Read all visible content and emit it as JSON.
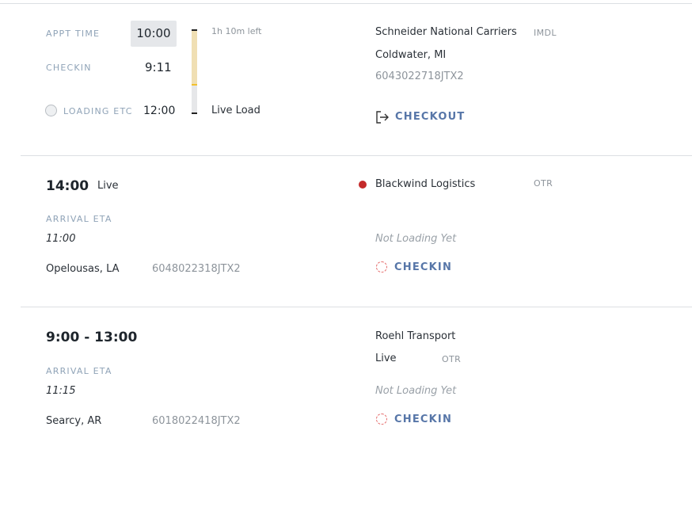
{
  "card1": {
    "appt_label": "APPT TIME",
    "appt_time": "10:00",
    "checkin_label": "CHECKIN",
    "checkin_time": "9:11",
    "loading_label": "LOADING ETC",
    "loading_time": "12:00",
    "time_left": "1h 10m left",
    "load_type": "Live Load",
    "carrier": "Schneider National Carriers",
    "carrier_tag": "IMDL",
    "location": "Coldwater, MI",
    "ref": "6043022718JTX2",
    "action_label": "CHECKOUT",
    "progress_fraction": 0.72
  },
  "card2": {
    "time": "14:00",
    "mode": "Live",
    "arrival_label": "ARRIVAL ETA",
    "arrival_time": "11:00",
    "location": "Opelousas, LA",
    "ref": "6048022318JTX2",
    "carrier": "Blackwind Logistics",
    "carrier_tag": "OTR",
    "status": "Not Loading Yet",
    "action_label": "CHECKIN",
    "status_color": "#c42a2a"
  },
  "card3": {
    "time": "9:00 - 13:00",
    "arrival_label": "ARRIVAL ETA",
    "arrival_time": "11:15",
    "location": "Searcy, AR",
    "ref": "6018022418JTX2",
    "carrier": "Roehl Transport",
    "mode": "Live",
    "carrier_tag": "OTR",
    "status": "Not Loading Yet",
    "action_label": "CHECKIN"
  },
  "colors": {
    "accent": "#5776a8",
    "progress": "#f0dfb3",
    "progress_marker": "#f2c12e",
    "divider": "#dcdfe3"
  }
}
